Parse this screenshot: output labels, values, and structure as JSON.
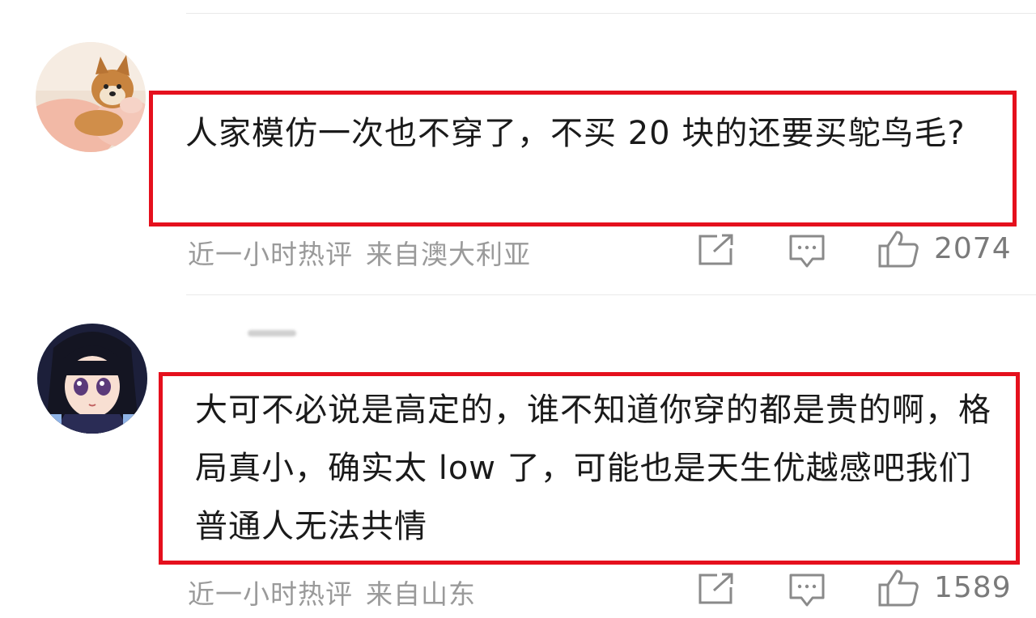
{
  "comments": [
    {
      "text": "人家模仿一次也不穿了，不买 20 块的还要买鸵鸟毛?",
      "time": "近一小时热评",
      "location": "来自澳大利亚",
      "likes": "2074",
      "avatar": "shiba-dog-avatar"
    },
    {
      "text": "大可不必说是高定的，谁不知道你穿的都是贵的啊，格局真小，确实太 low 了，可能也是天生优越感吧我们普通人无法共情",
      "time": "近一小时热评",
      "location": "来自山东",
      "likes": "1589",
      "avatar": "anime-girl-avatar"
    }
  ],
  "colors": {
    "highlight_border": "#e5101d",
    "meta_text": "#9a9a9a"
  },
  "icons": [
    "share-icon",
    "comment-icon",
    "like-icon"
  ]
}
